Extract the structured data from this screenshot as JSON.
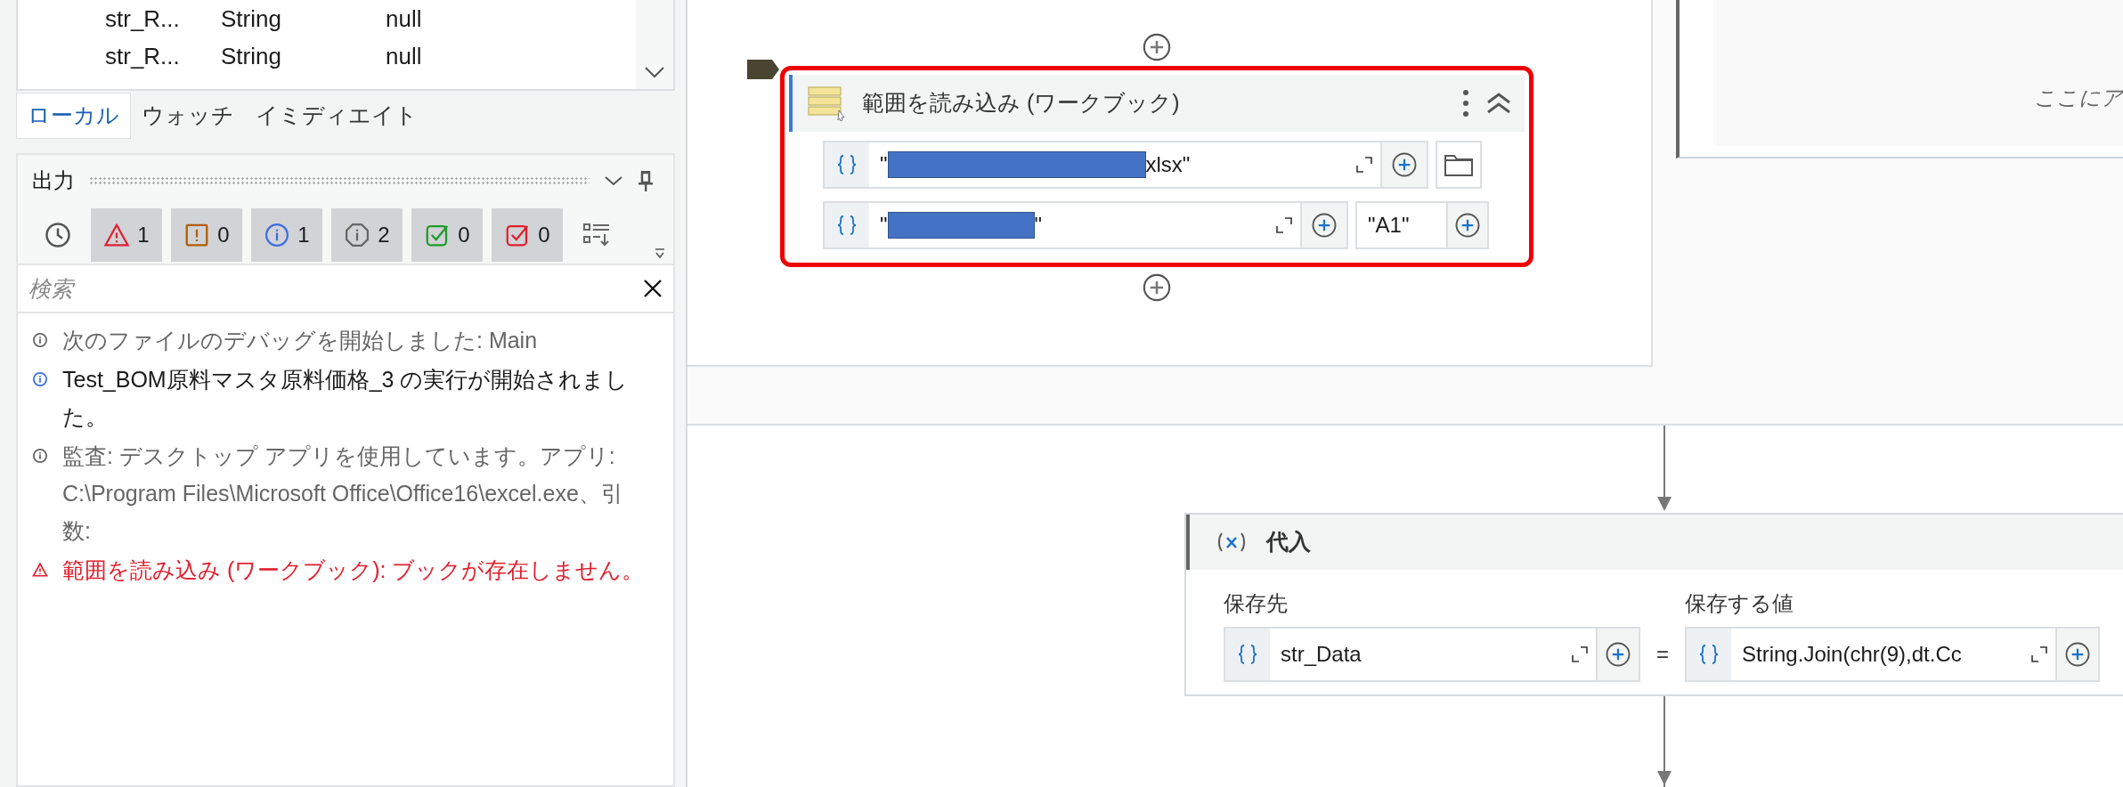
{
  "variables": {
    "rows": [
      {
        "name": "str_R...",
        "type": "String",
        "value": "null"
      },
      {
        "name": "str_R...",
        "type": "String",
        "value": "null"
      }
    ]
  },
  "debug_tabs": [
    {
      "label": "ローカル",
      "selected": true
    },
    {
      "label": "ウォッチ",
      "selected": false
    },
    {
      "label": "イミディエイト",
      "selected": false
    }
  ],
  "output": {
    "title": "出力",
    "filters": [
      {
        "kind": "error",
        "count": "1",
        "selected": true
      },
      {
        "kind": "warning",
        "count": "0",
        "selected": true
      },
      {
        "kind": "info",
        "count": "1",
        "selected": true
      },
      {
        "kind": "trace",
        "count": "2",
        "selected": true
      },
      {
        "kind": "success",
        "count": "0",
        "selected": true
      },
      {
        "kind": "failure",
        "count": "0",
        "selected": true
      }
    ],
    "search": {
      "placeholder": "検索"
    },
    "log": [
      {
        "kind": "trace",
        "text": "次のファイルのデバッグを開始しました: Main"
      },
      {
        "kind": "info",
        "text": "Test_BOM原料マスタ原料価格_3 の実行が開始されました。"
      },
      {
        "kind": "trace",
        "text": "監査: デスクトップ アプリを使用しています。アプリ: C:\\Program Files\\Microsoft Office\\Office16\\excel.exe、引数:"
      },
      {
        "kind": "error",
        "text": "範囲を読み込み (ワークブック): ブックが存在しません。"
      }
    ]
  },
  "canvas": {
    "drop_hint": "ここにア",
    "read_range": {
      "title": "範囲を読み込み (ワークブック)",
      "highlighted": true,
      "workbook_path": {
        "value_start": "\"",
        "value_end": "xlsx\"",
        "redacted": true
      },
      "sheet_name": {
        "value_start": "\"",
        "value_end": "\"",
        "redacted": true
      },
      "range": "\"A1\""
    },
    "assign": {
      "title": "代入",
      "to_label": "保存先",
      "to": "str_Data",
      "operator": "=",
      "value_label": "保存する値",
      "value": "String.Join(chr(9),dt.Cc"
    }
  }
}
